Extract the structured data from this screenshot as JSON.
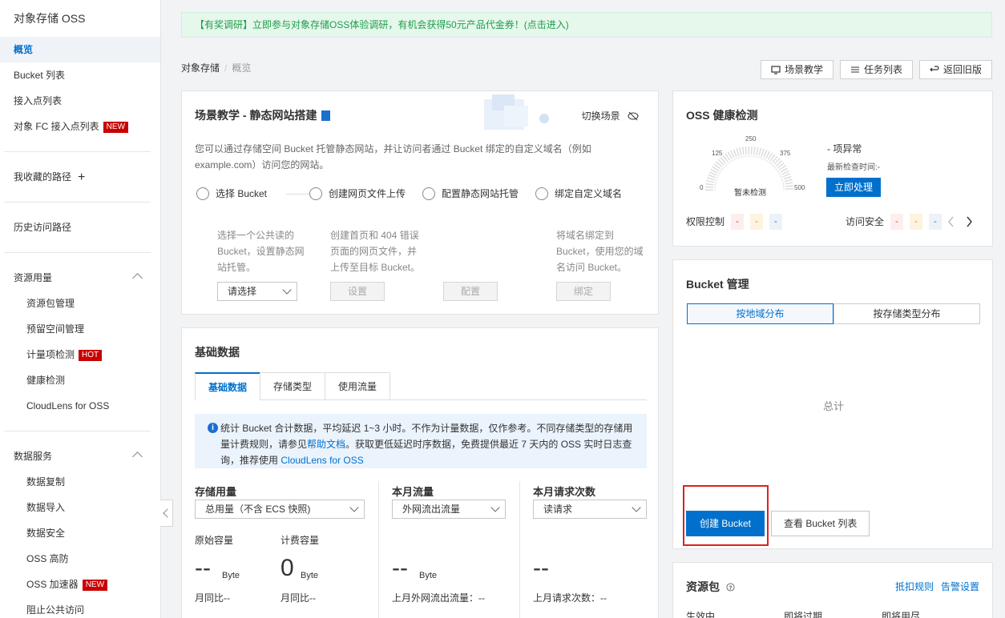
{
  "sidebar": {
    "title": "对象存储 OSS",
    "items": [
      {
        "label": "概览"
      },
      {
        "label": "Bucket 列表"
      },
      {
        "label": "接入点列表"
      },
      {
        "label": "对象 FC 接入点列表",
        "badge": "NEW"
      }
    ],
    "favorites": "我收藏的路径",
    "history": "历史访问路径",
    "resource_group": "资源用量",
    "resource_items": [
      {
        "label": "资源包管理"
      },
      {
        "label": "预留空间管理"
      },
      {
        "label": "计量项检测",
        "badge": "HOT"
      },
      {
        "label": "健康检测"
      },
      {
        "label": "CloudLens for OSS"
      }
    ],
    "data_group": "数据服务",
    "data_items": [
      {
        "label": "数据复制"
      },
      {
        "label": "数据导入"
      },
      {
        "label": "数据安全"
      },
      {
        "label": "OSS 高防"
      },
      {
        "label": "OSS 加速器",
        "badge": "NEW"
      },
      {
        "label": "阻止公共访问"
      }
    ]
  },
  "banner": "【有奖调研】立即参与对象存储OSS体验调研，有机会获得50元产品代金券！(点击进入)",
  "breadcrumb": {
    "root": "对象存储",
    "separator": "/",
    "current": "概览"
  },
  "top_buttons": {
    "tutorial": "场景教学",
    "tasks": "任务列表",
    "old": "返回旧版"
  },
  "scene": {
    "title": "场景教学 - 静态网站搭建",
    "switch": "切换场景",
    "desc": "您可以通过存储空间 Bucket 托管静态网站，并让访问者通过 Bucket 绑定的自定义域名（例如 example.com）访问您的网站。",
    "steps": [
      {
        "label": "选择 Bucket",
        "desc": "选择一个公共读的 Bucket，设置静态网站托管。",
        "control": "请选择"
      },
      {
        "label": "创建网页文件上传",
        "desc": "创建首页和 404 错误页面的网页文件，并上传至目标 Bucket。",
        "control": "设置"
      },
      {
        "label": "配置静态网站托管",
        "desc": "",
        "control": "配置"
      },
      {
        "label": "绑定自定义域名",
        "desc": "将域名绑定到 Bucket，使用您的域名访问 Bucket。",
        "control": "绑定"
      }
    ]
  },
  "basic": {
    "title": "基础数据",
    "tabs": [
      "基础数据",
      "存储类型",
      "使用流量"
    ],
    "info_prefix": "统计 Bucket 合计数据，平均延迟 1~3 小时。不作为计量数据，仅作参考。不同存储类型的存储用量计费规则，请参见",
    "info_link1": "帮助文档",
    "info_mid": "。获取更低延迟时序数据，免费提供最近 7 天内的 OSS 实时日志查询，推荐使用",
    "info_link2": "CloudLens for OSS",
    "storage": {
      "label": "存储用量",
      "select": "总用量（不含 ECS 快照)",
      "raw_label": "原始容量",
      "raw_value": "--",
      "raw_unit": "Byte",
      "raw_mom": "月同比--",
      "bill_label": "计费容量",
      "bill_value": "0",
      "bill_unit": "Byte",
      "bill_mom": "月同比--"
    },
    "traffic": {
      "label": "本月流量",
      "select": "外网流出流量",
      "value": "--",
      "unit": "Byte",
      "last": "上月外网流出流量：--"
    },
    "requests": {
      "label": "本月请求次数",
      "select": "读请求",
      "value": "--",
      "last": "上月请求次数：--"
    }
  },
  "health": {
    "title": "OSS 健康检测",
    "gauge_labels": [
      "0",
      "125",
      "250",
      "375",
      "500"
    ],
    "gauge_center": "暂未检测",
    "abnormal": "- 项异常",
    "last_check": "最新检查时间:-",
    "action": "立即处理",
    "perm_label": "权限控制",
    "perm_values": [
      "-",
      "-",
      "-"
    ],
    "access_label": "访问安全",
    "access_values": [
      "-",
      "-",
      "-"
    ]
  },
  "bucket": {
    "title": "Bucket 管理",
    "seg": [
      "按地域分布",
      "按存储类型分布"
    ],
    "total": "总计",
    "create": "创建 Bucket",
    "view": "查看 Bucket 列表"
  },
  "res": {
    "title": "资源包",
    "link1": "抵扣规则",
    "link2": "告警设置",
    "labels": [
      "生效中",
      "即将过期",
      "即将用尽"
    ]
  }
}
